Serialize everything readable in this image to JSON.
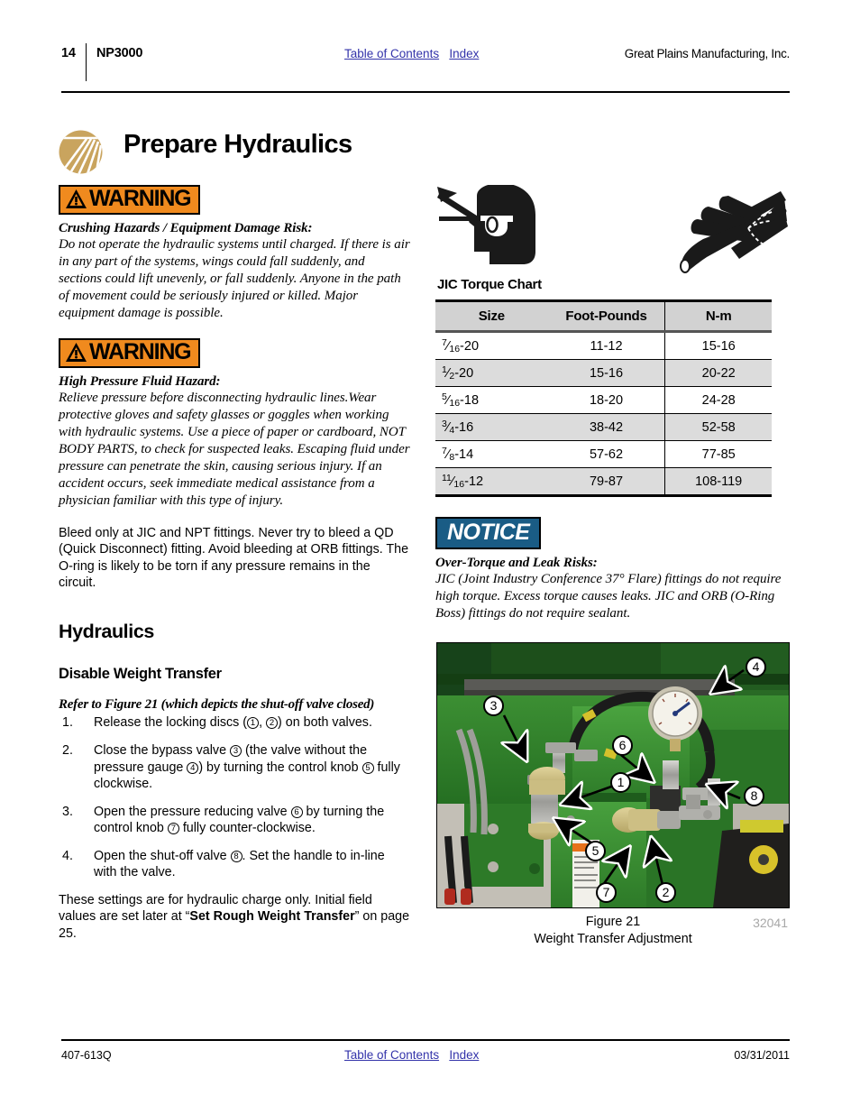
{
  "header": {
    "page_number": "14",
    "model": "NP3000",
    "toc_link": "Table of Contents",
    "index_link": "Index",
    "company": "Great Plains Manufacturing, Inc."
  },
  "section": {
    "title": "Prepare Hydraulics",
    "logo_color": "#c9a45e"
  },
  "warnings": [
    {
      "badge": "WARNING",
      "badge_color": "#f08a1e",
      "title": "Crushing Hazards / Equipment Damage Risk:",
      "body": "Do not operate the hydraulic systems until charged. If there is air in any part of the systems, wings could fall suddenly, and sections could lift unevenly, or fall suddenly. Anyone in the path of movement could be seriously injured or killed. Major equipment damage is possible."
    },
    {
      "badge": "WARNING",
      "badge_color": "#f08a1e",
      "title": "High Pressure Fluid Hazard:",
      "body": "Relieve pressure before disconnecting hydraulic lines.Wear protective gloves and safety glasses or goggles when working with hydraulic systems. Use a piece of paper or cardboard, NOT BODY PARTS, to check for suspected leaks. Escaping fluid under pressure can penetrate the skin, causing serious injury. If an accident occurs, seek immediate medical assistance from a physician familiar with this type of injury."
    }
  ],
  "bleed_notes": "Bleed only at JIC and NPT fittings. Never try to bleed a QD (Quick Disconnect) fitting. Avoid bleeding at ORB fittings. The O-ring is likely to be torn if any pressure remains in the circuit.",
  "headings": {
    "hydraulics": "Hydraulics",
    "disable_weight_transfer": "Disable Weight Transfer"
  },
  "refer_line": "Refer to Figure 21 (which depicts the shut-off valve closed)",
  "steps": [
    {
      "number": "1.",
      "html": "Release the locking discs (<span class=\"cnum\">1</span>, <span class=\"cnum\">2</span>) on both valves."
    },
    {
      "number": "2.",
      "html": "Close the bypass valve <span class=\"cnum\">3</span> (the valve without the pressure gauge <span class=\"cnum\">4</span>) by turning the control knob <span class=\"cnum\">5</span> fully clockwise."
    },
    {
      "number": "3.",
      "html": "Open the pressure reducing valve <span class=\"cnum\">6</span> by turning the control knob <span class=\"cnum\">7</span> fully counter-clockwise."
    },
    {
      "number": "4.",
      "html": "Open the shut-off valve <span class=\"cnum\">8</span>. Set the handle to in-line with the valve."
    }
  ],
  "closing_note_html": "These settings are for hydraulic charge only. Initial field values are set later at &ldquo;<b>Set Rough Weight Transfer</b>&rdquo; on page 25.",
  "pictograms": [
    {
      "name": "eye-protection-icon"
    },
    {
      "name": "fluid-injection-hazard-icon"
    }
  ],
  "torque_chart": {
    "title": "JIC Torque Chart",
    "columns": [
      "Size",
      "Foot-Pounds",
      "N-m"
    ],
    "rows": [
      {
        "size_num": "7",
        "size_den": "16",
        "size_suffix": "-20",
        "foot_pounds": "11-12",
        "nm": "15-16"
      },
      {
        "size_num": "1",
        "size_den": "2",
        "size_suffix": "-20",
        "foot_pounds": "15-16",
        "nm": "20-22"
      },
      {
        "size_num": "5",
        "size_den": "16",
        "size_suffix": "-18",
        "foot_pounds": "18-20",
        "nm": "24-28"
      },
      {
        "size_num": "3",
        "size_den": "4",
        "size_suffix": "-16",
        "foot_pounds": "38-42",
        "nm": "52-58"
      },
      {
        "size_num": "7",
        "size_den": "8",
        "size_suffix": "-14",
        "foot_pounds": "57-62",
        "nm": "77-85"
      },
      {
        "size_num": "11",
        "size_den": "16",
        "size_suffix": "-12",
        "foot_pounds": "79-87",
        "nm": "108-119"
      }
    ]
  },
  "notice": {
    "badge": "NOTICE",
    "badge_color": "#1a5c85",
    "title": "Over-Torque and Leak Risks:",
    "body": "JIC (Joint Industry Conference 37° Flare) fittings do not require high torque. Excess torque causes leaks. JIC and ORB (O-Ring Boss) fittings do not require sealant."
  },
  "figure": {
    "number": "Figure 21",
    "caption": "Weight Transfer Adjustment",
    "image_id": "32041",
    "callouts": [
      "1",
      "2",
      "3",
      "4",
      "5",
      "6",
      "7",
      "8"
    ]
  },
  "footer": {
    "doc_number": "407-613Q",
    "toc_link": "Table of Contents",
    "index_link": "Index",
    "date": "03/31/2011"
  }
}
